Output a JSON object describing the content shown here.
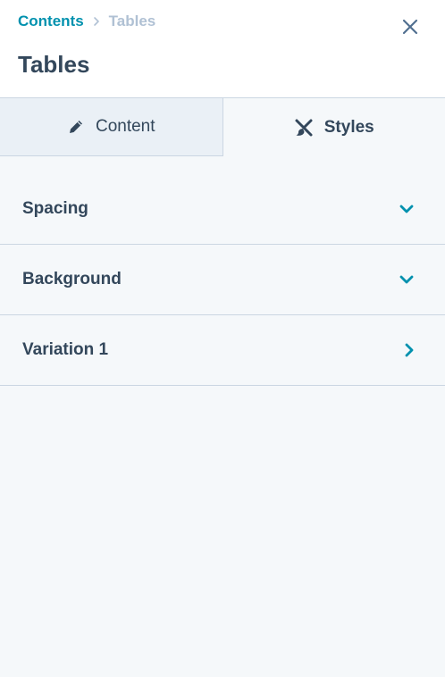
{
  "breadcrumb": {
    "parent": "Contents",
    "current": "Tables"
  },
  "header": {
    "title": "Tables",
    "close_icon": "close-icon"
  },
  "tabs": [
    {
      "label": "Content",
      "icon": "pencil-icon",
      "active": false
    },
    {
      "label": "Styles",
      "icon": "brush-icon",
      "active": true
    }
  ],
  "sections": [
    {
      "label": "Spacing",
      "icon": "chevron-down-icon"
    },
    {
      "label": "Background",
      "icon": "chevron-down-icon"
    },
    {
      "label": "Variation 1",
      "icon": "chevron-right-icon"
    }
  ],
  "colors": {
    "accent": "#0091ae",
    "text": "#33475b",
    "muted": "#b0c1d4",
    "border": "#cbd6e2",
    "panel_bg": "#f5f8fa",
    "tab_inactive_bg": "#eaf0f6"
  }
}
